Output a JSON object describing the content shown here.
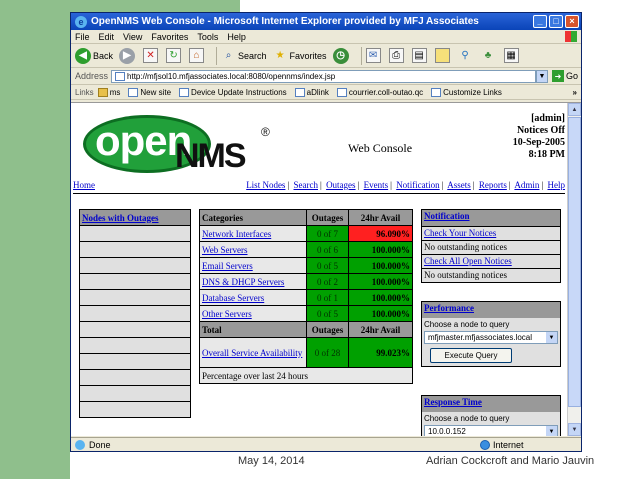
{
  "window": {
    "title": "OpenNMS Web Console - Microsoft Internet Explorer provided by MFJ Associates",
    "min_glyph": "_",
    "max_glyph": "□",
    "close_glyph": "×"
  },
  "menu": [
    "File",
    "Edit",
    "View",
    "Favorites",
    "Tools",
    "Help"
  ],
  "toolbar": {
    "back": "Back",
    "search": "Search",
    "favorites": "Favorites"
  },
  "address": {
    "label": "Address",
    "url": "http://mfjsol10.mfjassociates.local:8080/opennms/index.jsp",
    "go": "Go"
  },
  "links": {
    "label": "Links",
    "items": [
      "ms",
      "New site",
      "Device Update Instructions",
      "aDlink",
      "courrier.coll-outao.qc",
      "Customize Links"
    ],
    "more": "»"
  },
  "logo": {
    "open": "open",
    "nms": "NMS",
    "reg": "®"
  },
  "page": {
    "heading": "Web Console",
    "user": "[admin]",
    "notices": "Notices Off",
    "date": "10-Sep-2005",
    "time": "8:18 PM"
  },
  "nav": {
    "home": "Home",
    "links": [
      "List Nodes",
      "Search",
      "Outages",
      "Events",
      "Notification",
      "Assets",
      "Reports",
      "Admin",
      "Help"
    ],
    "sep": "|"
  },
  "nodes_with_outages": {
    "title": "Nodes with Outages",
    "rows": 13
  },
  "categories": {
    "headers": [
      "Categories",
      "Outages",
      "24hr Avail"
    ],
    "rows": [
      {
        "name": "Network Interfaces",
        "outages": "0 of 7",
        "avail": "96.090%",
        "status": "bad"
      },
      {
        "name": "Web Servers",
        "outages": "0 of 6",
        "avail": "100.000%",
        "status": "good"
      },
      {
        "name": "Email Servers",
        "outages": "0 of 5",
        "avail": "100.000%",
        "status": "good"
      },
      {
        "name": "DNS & DHCP Servers",
        "outages": "0 of 2",
        "avail": "100.000%",
        "status": "good"
      },
      {
        "name": "Database Servers",
        "outages": "0 of 1",
        "avail": "100.000%",
        "status": "good"
      },
      {
        "name": "Other Servers",
        "outages": "0 of 5",
        "avail": "100.000%",
        "status": "good"
      }
    ],
    "total_headers": [
      "Total",
      "Outages",
      "24hr Avail"
    ],
    "total": {
      "name": "Overall Service Availability",
      "outages": "0 of 28",
      "avail": "99.023%"
    },
    "footnote": "Percentage over last 24 hours"
  },
  "notification": {
    "title": "Notification",
    "rows": [
      {
        "text": "Check Your Notices",
        "link": true
      },
      {
        "text": "No outstanding notices",
        "link": false
      },
      {
        "text": "Check All Open Notices",
        "link": true
      },
      {
        "text": "No outstanding notices",
        "link": false
      }
    ]
  },
  "performance": {
    "title": "Performance",
    "label": "Choose a node to query",
    "selected": "mfjmaster.mfjassociates.local",
    "button": "Execute Query"
  },
  "response_time": {
    "title": "Response Time",
    "label": "Choose a node to query",
    "selected": "10.0.0.152"
  },
  "status": {
    "text": "Done",
    "zone": "Internet"
  },
  "footer": {
    "date": "May 14, 2014",
    "authors": "Adrian Cockcroft and Mario Jauvin"
  },
  "colors": {
    "good": "#00a000",
    "bad": "#ff2020",
    "header_gray": "#999999",
    "logo_green": "#21a03a"
  }
}
